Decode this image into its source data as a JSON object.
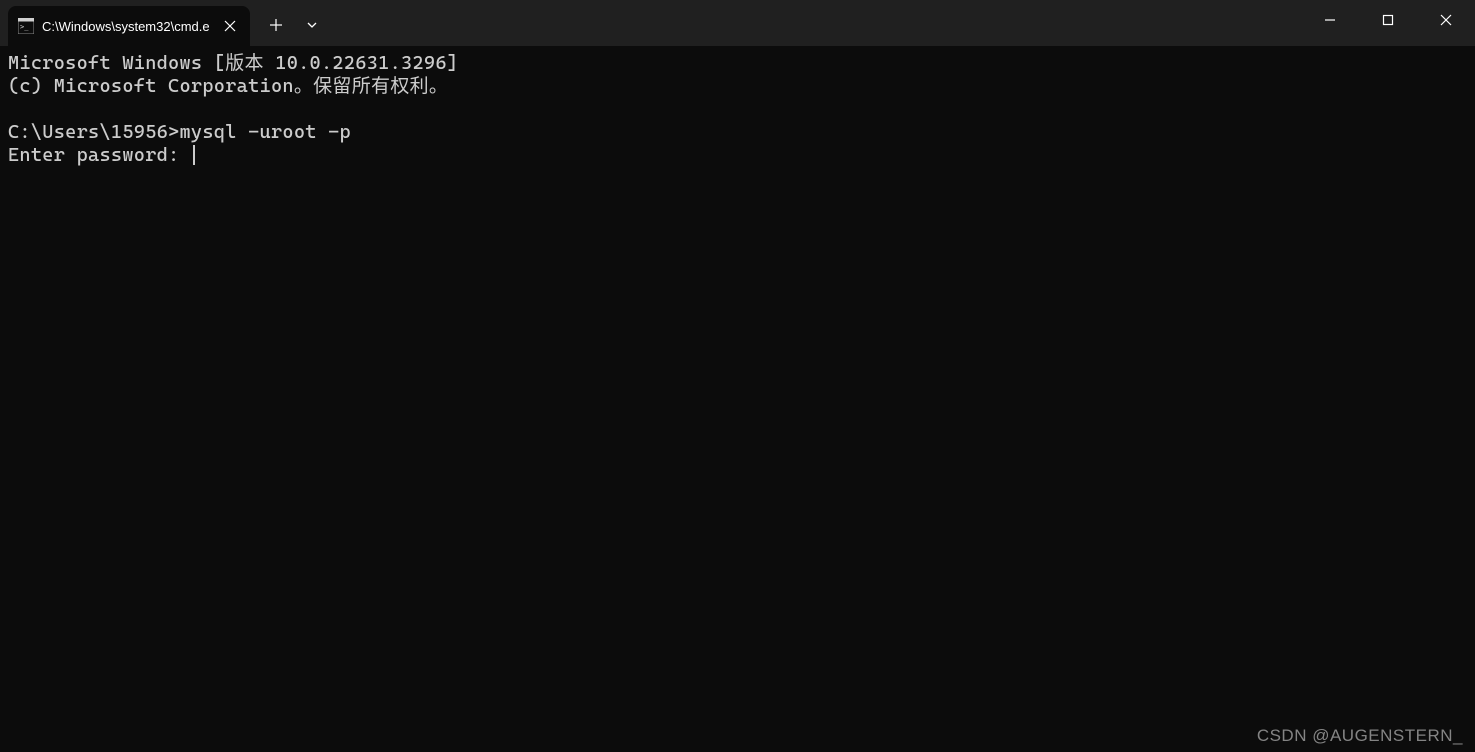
{
  "tab": {
    "title": "C:\\Windows\\system32\\cmd.e"
  },
  "terminal": {
    "line1": "Microsoft Windows [版本 10.0.22631.3296]",
    "line2": "(c) Microsoft Corporation。保留所有权利。",
    "line3": "",
    "prompt": "C:\\Users\\15956>",
    "command": "mysql -uroot -p",
    "passwordPrompt": "Enter password: "
  },
  "watermark": "CSDN @AUGENSTERN_"
}
